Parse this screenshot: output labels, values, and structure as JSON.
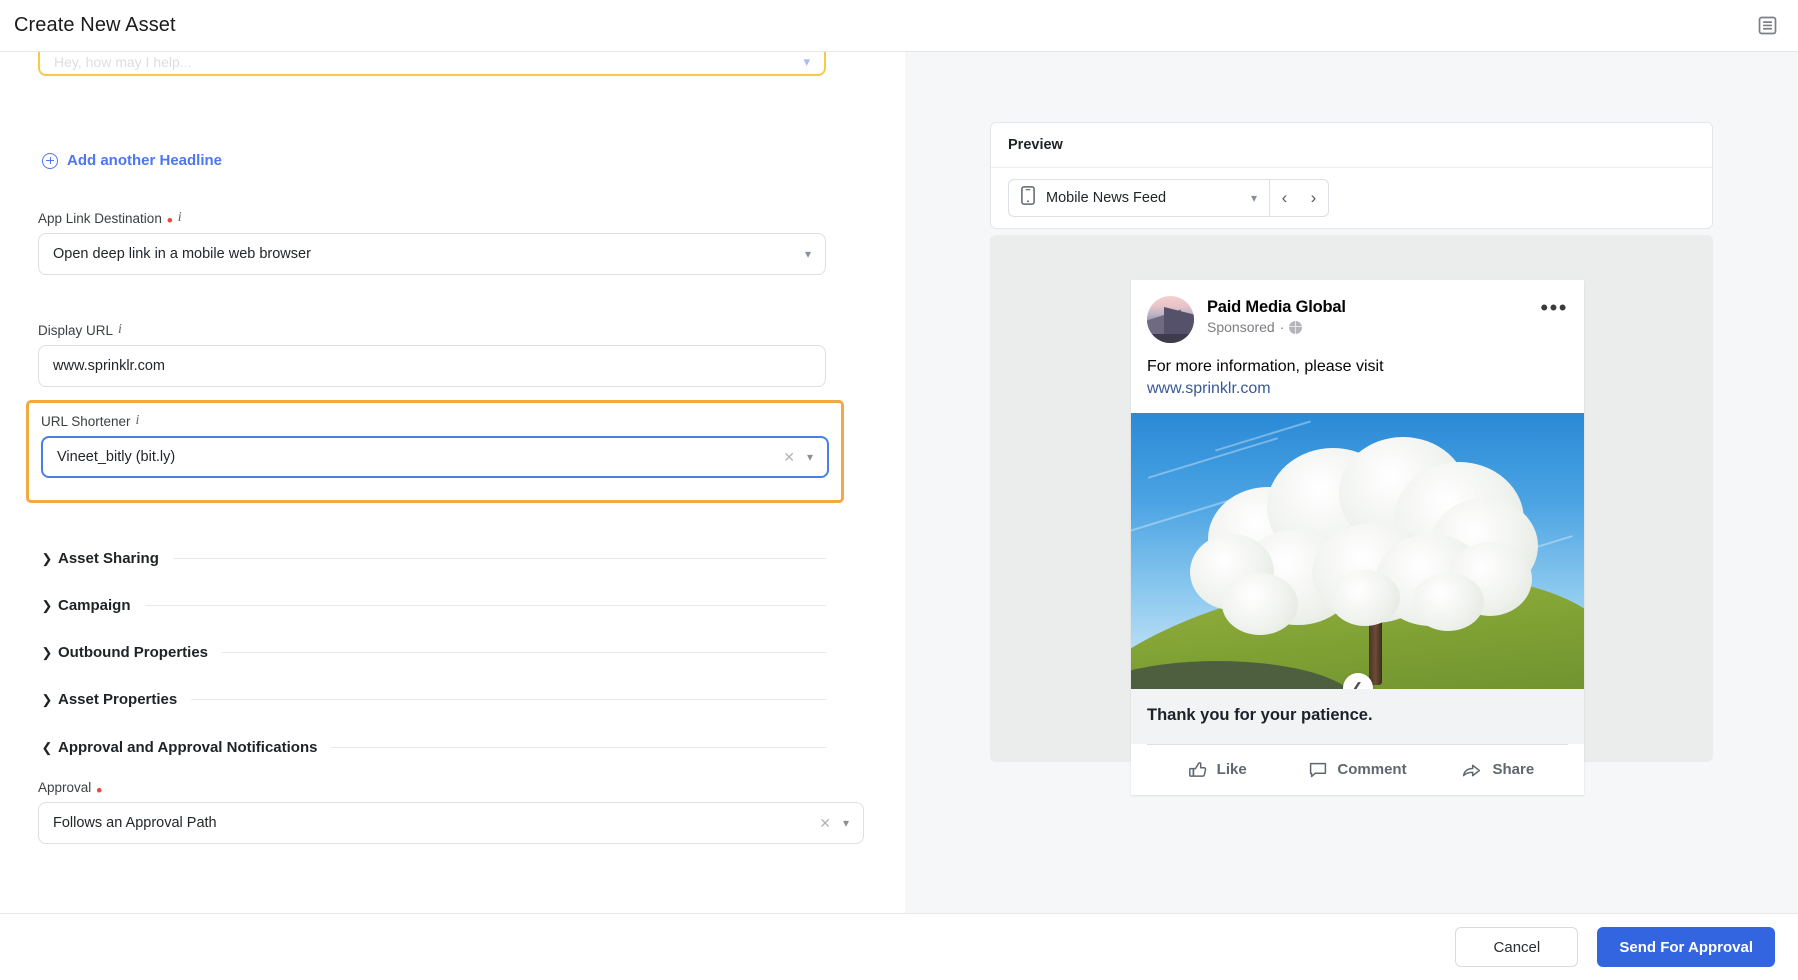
{
  "header": {
    "title": "Create New Asset",
    "right_icon": "document-list-icon"
  },
  "form": {
    "cutoff_field": {
      "placeholder": "Hey, how may I help...",
      "chevron": "chevron-down-icon"
    },
    "add_headline_link": "Add another Headline",
    "fields": [
      {
        "label": "App Link Destination",
        "required": true,
        "has_info": true,
        "value": "Open deep link in a mobile web browser",
        "control": "select",
        "clearable": false
      },
      {
        "label": "Display URL",
        "required": false,
        "has_info": true,
        "value": "www.sprinklr.com",
        "control": "text",
        "clearable": false
      },
      {
        "label": "URL Shortener",
        "required": false,
        "has_info": true,
        "value": "Vineet_bitly (bit.ly)",
        "control": "select",
        "clearable": true,
        "highlighted": true,
        "focused": true
      }
    ],
    "sections": [
      {
        "title": "Asset Sharing",
        "expanded": false,
        "caret": "chevron-right-icon"
      },
      {
        "title": "Campaign",
        "expanded": false,
        "caret": "chevron-right-icon"
      },
      {
        "title": "Outbound Properties",
        "expanded": false,
        "caret": "chevron-right-icon"
      },
      {
        "title": "Asset Properties",
        "expanded": false,
        "caret": "chevron-right-icon"
      },
      {
        "title": "Approval and Approval Notifications",
        "expanded": true,
        "caret": "chevron-down-icon"
      }
    ],
    "approval": {
      "label": "Approval",
      "required": true,
      "value": "Follows an Approval Path",
      "clear_icon": "close-icon",
      "chevron": "chevron-down-icon"
    }
  },
  "preview": {
    "title": "Preview",
    "placement_select": {
      "icon": "mobile-phone-icon",
      "value": "Mobile News Feed",
      "chevron": "chevron-down-icon"
    },
    "nav": {
      "prev": "‹",
      "next": "›"
    },
    "ad": {
      "avatar": "brand-avatar",
      "brand": "Paid Media Global",
      "sponsored": "Sponsored",
      "separator": "·",
      "audience_icon": "globe-icon",
      "more_icon": "more-options-icon",
      "primary_text": "For more information, please visit",
      "link_text": "www.sprinklr.com",
      "image_alt": "blossoming-tree-on-hillside",
      "expand_icon": "chevron-up-icon",
      "headline": "Thank you for your patience.",
      "actions": [
        {
          "label": "Like",
          "icon": "thumbs-up-icon"
        },
        {
          "label": "Comment",
          "icon": "comment-bubble-icon"
        },
        {
          "label": "Share",
          "icon": "share-arrow-icon"
        }
      ]
    }
  },
  "footer": {
    "cancel_label": "Cancel",
    "submit_label": "Send For Approval"
  },
  "colors": {
    "primary": "#3465e0",
    "link": "#4d76f3",
    "highlight_border": "#efab3f",
    "focus_border": "#4a7fe8",
    "required": "#e8483f",
    "fb_link": "#385898"
  }
}
